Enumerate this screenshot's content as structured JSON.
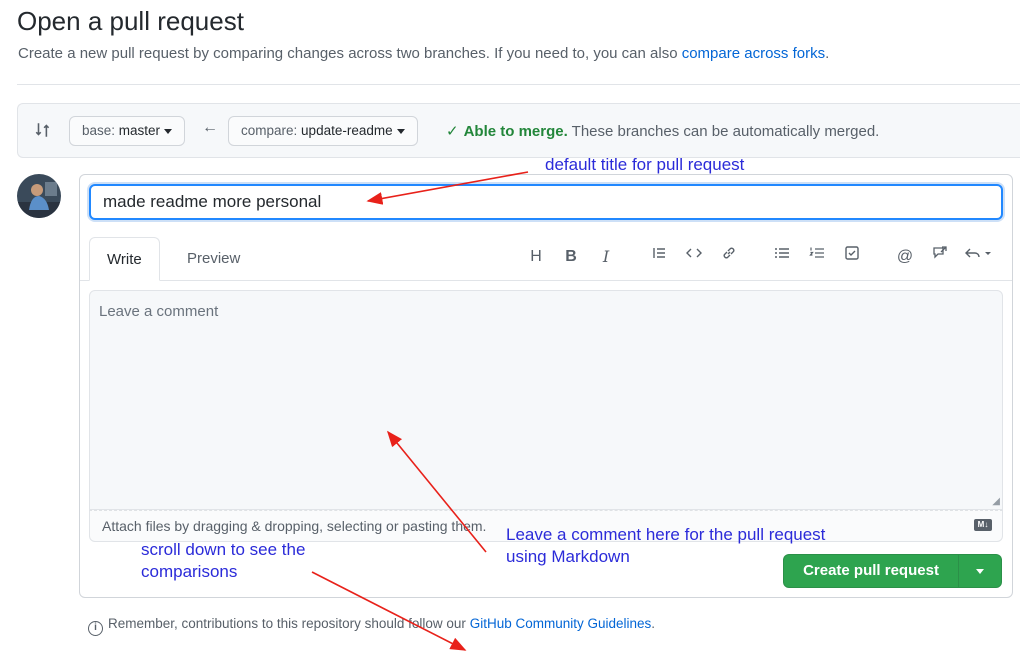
{
  "header": {
    "title": "Open a pull request",
    "subtitle": "Create a new pull request by comparing changes across two branches. If you need to, you can also",
    "subtitle_link": "compare across forks",
    "subtitle_end": "."
  },
  "range": {
    "base_prefix": "base:",
    "base_branch": "master",
    "compare_prefix": "compare:",
    "compare_branch": "update-readme",
    "merge_ok": "Able to merge.",
    "merge_text": "These branches can be automatically merged."
  },
  "form": {
    "title_value": "made readme more personal",
    "tab_write": "Write",
    "tab_preview": "Preview",
    "toolbar": [
      "heading-icon",
      "bold-icon",
      "italic-icon",
      "quote-icon",
      "code-icon",
      "link-icon",
      "unordered-list-icon",
      "ordered-list-icon",
      "task-list-icon",
      "mention-icon",
      "reference-icon",
      "reply-icon"
    ],
    "comment_placeholder": "Leave a comment",
    "attach_text": "Attach files by dragging & dropping, selecting or pasting them.",
    "create_label": "Create pull request"
  },
  "footer": {
    "text": "Remember, contributions to this repository should follow our",
    "link": "GitHub Community Guidelines",
    "end": "."
  },
  "annotations": {
    "title_note": "default title for pull request",
    "comment_note_line1": "Leave a comment here for the pull request",
    "comment_note_line2": "using Markdown",
    "scroll_note_line1": "scroll down to see the",
    "scroll_note_line2": "comparisons"
  },
  "colors": {
    "accent": "#0366d6",
    "create_button": "#2ea44f",
    "merge_ok": "#22863a",
    "annotation_text": "#2b2bd9",
    "annotation_arrow": "#e8211a"
  }
}
